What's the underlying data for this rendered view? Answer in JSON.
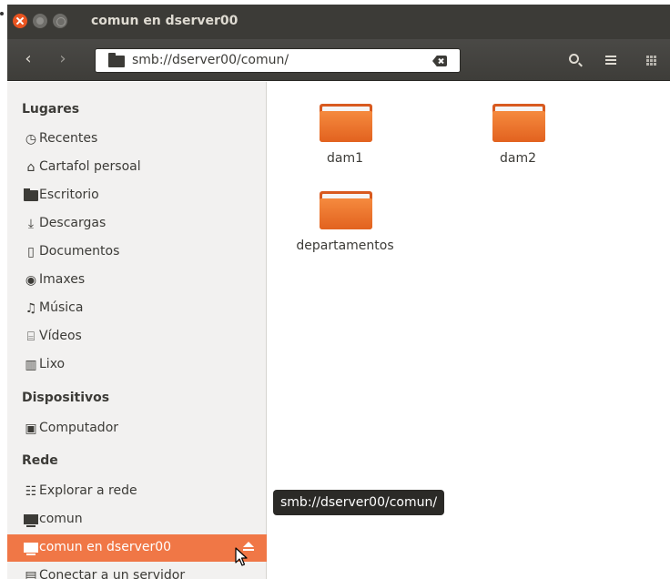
{
  "window": {
    "title": "comun en dserver00"
  },
  "toolbar": {
    "location": "smb://dserver00/comun/"
  },
  "sidebar": {
    "sections": {
      "places": "Lugares",
      "devices": "Dispositivos",
      "network": "Rede"
    },
    "places": [
      {
        "label": "Recentes",
        "icon": "clock-icon"
      },
      {
        "label": "Cartafol persoal",
        "icon": "home-icon"
      },
      {
        "label": "Escritorio",
        "icon": "desktop-folder-icon"
      },
      {
        "label": "Descargas",
        "icon": "download-icon"
      },
      {
        "label": "Documentos",
        "icon": "document-icon"
      },
      {
        "label": "Imaxes",
        "icon": "camera-icon"
      },
      {
        "label": "Música",
        "icon": "music-icon"
      },
      {
        "label": "Vídeos",
        "icon": "film-icon"
      },
      {
        "label": "Lixo",
        "icon": "trash-icon"
      }
    ],
    "devices": [
      {
        "label": "Computador",
        "icon": "computer-icon"
      }
    ],
    "network": [
      {
        "label": "Explorar a rede",
        "icon": "network-icon"
      },
      {
        "label": "comun",
        "icon": "network-share-icon"
      },
      {
        "label": "comun en dserver00",
        "icon": "network-share-icon",
        "selected": true
      },
      {
        "label": "Conectar a un servidor",
        "icon": "server-icon"
      }
    ]
  },
  "content": {
    "items": [
      {
        "name": "dam1"
      },
      {
        "name": "dam2"
      },
      {
        "name": "departamentos"
      }
    ]
  },
  "tooltip": {
    "text": "smb://dserver00/comun/"
  },
  "colors": {
    "accent": "#f07746",
    "titlebar": "#3c3b37",
    "folder": "#e2621f"
  }
}
